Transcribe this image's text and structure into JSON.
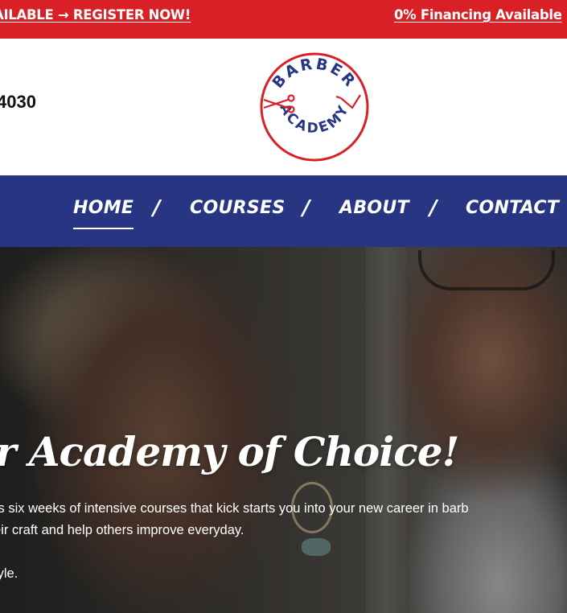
{
  "topbar": {
    "promo_left": "AILABLE → REGISTER NOW!",
    "promo_right": "0% Financing Available"
  },
  "header": {
    "phone": "4030",
    "logo": {
      "word_top": "BARBER",
      "word_bottom": "ACADEMY"
    }
  },
  "nav": {
    "items": [
      {
        "label": "HOME",
        "active": true
      },
      {
        "label": "COURSES"
      },
      {
        "label": "ABOUT"
      },
      {
        "label": "CONTACT"
      }
    ],
    "separator": "/"
  },
  "hero": {
    "title": "r Academy of Choice!",
    "line1": "rs six weeks of intensive courses that kick starts you into your new career in barb",
    "line2": "eir craft and help others improve everyday.",
    "line3": "tyle."
  },
  "colors": {
    "topbar_red": "#d92027",
    "nav_blue": "#283583",
    "logo_blue": "#283583",
    "logo_red": "#d92027"
  }
}
